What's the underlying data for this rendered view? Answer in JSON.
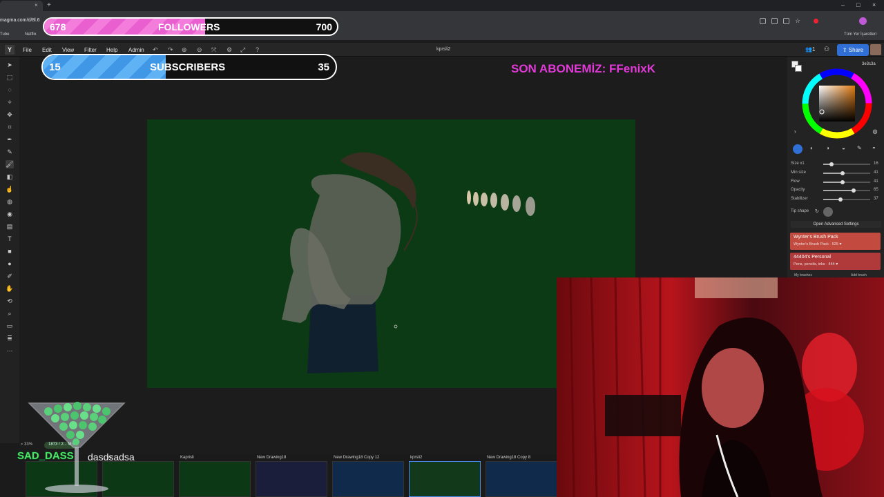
{
  "browser": {
    "url": "magma.com/d/8l.6",
    "new_tab": "+",
    "tab_close": "×",
    "bookmarks": [
      "Tube",
      "Netflix"
    ],
    "bookmarks_right": "Tüm Yer İşaretleri",
    "window_controls": [
      "–",
      "□",
      "×"
    ]
  },
  "app": {
    "logo": "Y",
    "menu": [
      "File",
      "Edit",
      "View",
      "Filter",
      "Help",
      "Admin"
    ],
    "document_name": "kprsli2",
    "users_count": "1",
    "share_label": "Share",
    "toolbar_icons": [
      "undo-icon",
      "redo-icon",
      "zoom-in-icon",
      "zoom-out-icon",
      "transform-icon",
      "settings-icon",
      "fullscreen-icon",
      "help-icon"
    ]
  },
  "left_tools": [
    "select-icon",
    "rect-select-icon",
    "lasso-icon",
    "magic-wand-icon",
    "move-icon",
    "crop-icon",
    "eyedropper-icon",
    "pencil-icon",
    "brush-icon",
    "eraser-icon",
    "smudge-icon",
    "blur-icon",
    "fill-icon",
    "gradient-icon",
    "text-icon",
    "rect-icon",
    "ellipse-icon",
    "pen-icon",
    "hand-icon",
    "rotate-icon",
    "zoom-icon",
    "comment-icon",
    "layers-icon",
    "more-icon"
  ],
  "right_panel": {
    "hex": "3e3c3a",
    "sliders": [
      {
        "label": "Size x1",
        "value": "16",
        "level": 0.18
      },
      {
        "label": "Min size",
        "value": "41",
        "level": 0.41
      },
      {
        "label": "Flow",
        "value": "41",
        "level": 0.41
      },
      {
        "label": "Opacity",
        "value": "65",
        "level": 0.65
      },
      {
        "label": "Stabilizer",
        "value": "37",
        "level": 0.37
      }
    ],
    "tip_shape_label": "Tip shape",
    "advanced_label": "Open Advanced Settings",
    "brush_packs": [
      {
        "title": "Wynter's Brush Pack",
        "subtitle": "Wynter's Brush Pack · 525 ♥"
      },
      {
        "title": "44404's Personal",
        "subtitle": "Pens, pencils, inks · 444 ♥"
      }
    ],
    "my_brushes_label": "My brushes",
    "add_brush_label": "Add brush"
  },
  "overlays": {
    "followers": {
      "left": "678",
      "label": "FOLLOWERS",
      "right": "700",
      "progress": 0.55
    },
    "subscribers": {
      "left": "15",
      "label": "SUBSCRIBERS",
      "right": "35",
      "progress": 0.42
    },
    "son_abone": "SON ABONEMİZ: FFenixK",
    "chat_user": "SAD_DASS",
    "chat_message": "dasdsadsa"
  },
  "bottom": {
    "zoom": "33%",
    "size": "1873 / 2... M 5",
    "files": [
      {
        "name": "",
        "active": false
      },
      {
        "name": "...py",
        "active": false
      },
      {
        "name": "Kaprisli",
        "active": false
      },
      {
        "name": "New Drawing18",
        "active": false
      },
      {
        "name": "New Drawing18 Copy 12",
        "active": false
      },
      {
        "name": "kprsli2",
        "active": true
      },
      {
        "name": "New Drawing18 Copy 8",
        "active": false
      }
    ]
  },
  "colors": {
    "canvas": "#0c3a14",
    "followers_fill": "#f06bd8",
    "subscribers_fill": "#4aa3f0",
    "accent": "#2f6fd6",
    "son_abone": "#e23ad8",
    "chat_user": "#69e86a"
  }
}
